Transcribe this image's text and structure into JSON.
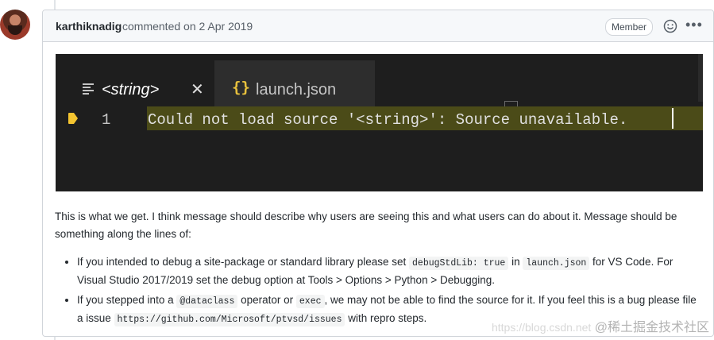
{
  "comment": {
    "author": "karthiknadig",
    "action": "commented on 2 Apr 2019",
    "badge": "Member",
    "icons": {
      "reaction": "smiley-icon",
      "more": "kebab-menu-icon",
      "avatar": "user-avatar"
    }
  },
  "editor": {
    "tabs": [
      {
        "label": "<string>",
        "icon": "file-lines-icon",
        "active": true,
        "close": "✕"
      },
      {
        "label": "launch.json",
        "icon": "json-braces-icon",
        "braces": "{}",
        "active": false
      }
    ],
    "line_number": "1",
    "code": "Could not load source '<string>': Source unavailable.",
    "colors": {
      "background": "#1e1e1e",
      "highlight": "#4b4b18",
      "braces": "#e8c13d",
      "breakpoint": "#f4c430"
    }
  },
  "body": {
    "paragraph_1": "This is what we get. I think message should describe why users are seeing this and what users can do about it. Message should be",
    "paragraph_2": "something along the lines of:",
    "bullet_1": {
      "part1": "If you intended to debug a site-package or standard library please set ",
      "code1": "debugStdLib: true",
      "part2": " in ",
      "code2": "launch.json",
      "part3": " for VS Code. For Visual Studio 2017/2019 set the debug option at Tools > Options > Python > Debugging."
    },
    "bullet_2": {
      "part1": "If you stepped into a ",
      "code1": "@dataclass",
      "part2": " operator or ",
      "code2": "exec",
      "part3": ", we may not be able to find the source for it. If you feel this is a bug please file a issue ",
      "code3": "https://github.com/Microsoft/ptvsd/issues",
      "part4": " with repro steps."
    }
  },
  "watermark": {
    "url": "https://blog.csdn.net",
    "text": "@稀土掘金技术社区"
  }
}
